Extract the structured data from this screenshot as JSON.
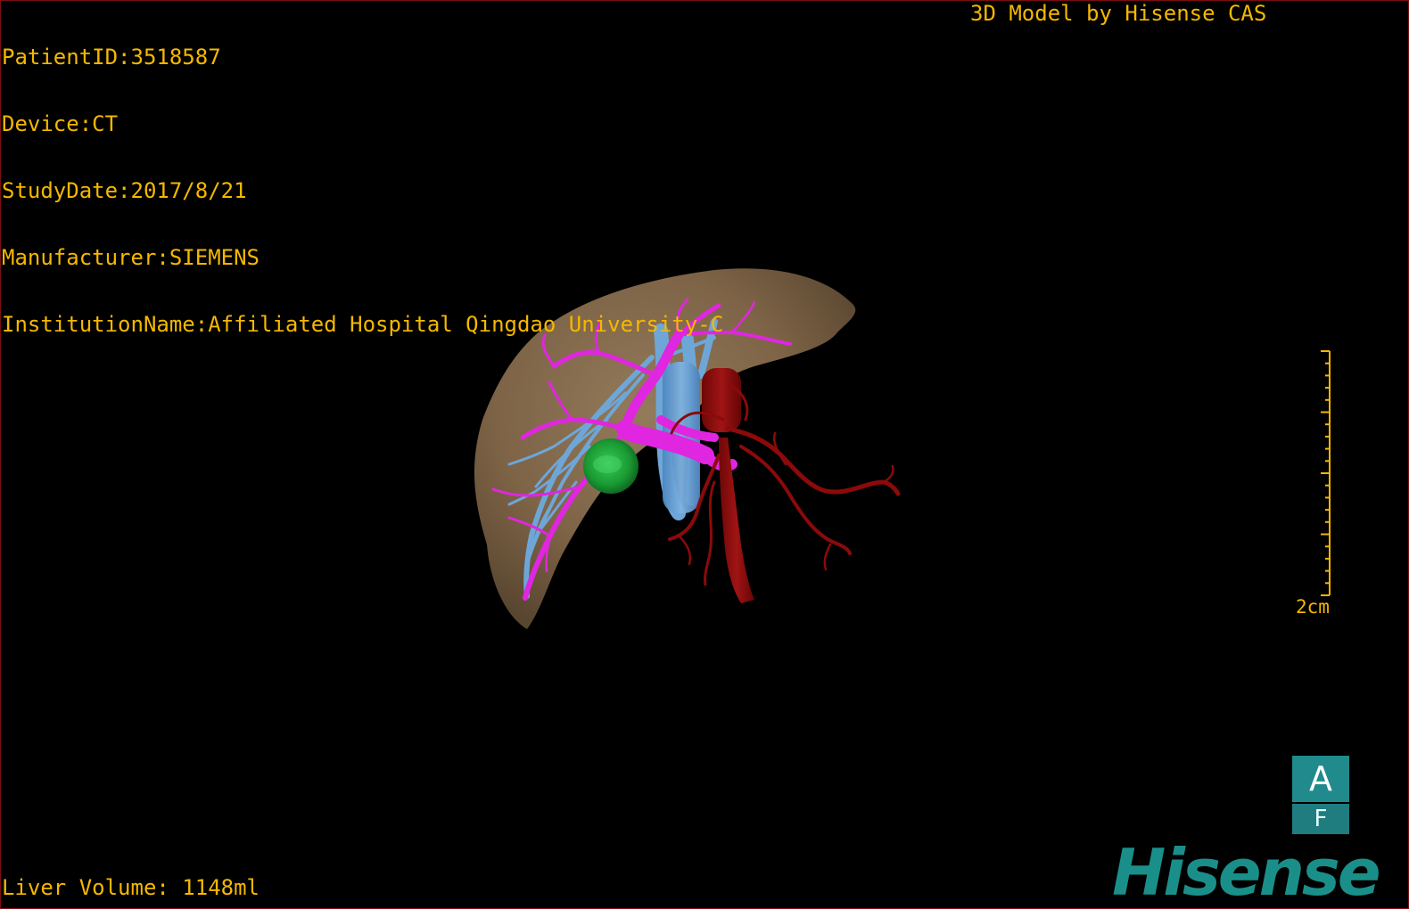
{
  "study_info": {
    "lines": [
      "PatientID:3518587",
      "Device:CT",
      "StudyDate:2017/8/21",
      "Manufacturer:SIEMENS",
      "InstitutionName:Affiliated Hospital Qingdao University-C"
    ]
  },
  "model_credit": "3D Model by Hisense CAS",
  "liver_volume": "Liver Volume: 1148ml",
  "scale_bar": {
    "label": "2cm"
  },
  "orientation": {
    "top_face": "A",
    "bottom_face": "F"
  },
  "brand": {
    "name": "Hisense",
    "color": "#1a8f8a"
  },
  "colors": {
    "overlay_text": "#f5b800",
    "liver": "#8a7150",
    "portal_vein": "#e026e0",
    "hepatic_vein": "#6ea6d8",
    "artery": "#8b0a0a",
    "lesion": "#1fa23a",
    "border": "#7a0d12"
  }
}
